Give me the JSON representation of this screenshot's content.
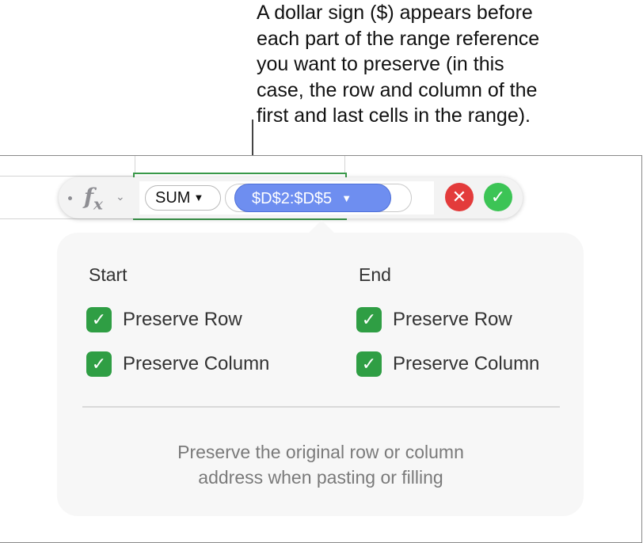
{
  "callout": {
    "text": "A dollar sign ($) appears before\neach part of the range reference\nyou want to preserve (in this\ncase, the row and column of the\nfirst and last cells in the range)."
  },
  "formula_bar": {
    "fx_label": "f",
    "fx_sub": "x",
    "function_token": "SUM",
    "range_token": "$D$2:$D$5",
    "dropdown_glyph": "▾",
    "cancel_glyph": "✕",
    "accept_glyph": "✓"
  },
  "popover": {
    "start": {
      "heading": "Start",
      "preserve_row": "Preserve Row",
      "preserve_column": "Preserve Column",
      "row_checked": true,
      "column_checked": true
    },
    "end": {
      "heading": "End",
      "preserve_row": "Preserve Row",
      "preserve_column": "Preserve Column",
      "row_checked": true,
      "column_checked": true
    },
    "hint": "Preserve the original row or column\naddress when pasting or filling"
  },
  "colors": {
    "range_token": "#6e8ef0",
    "cancel": "#e33b3b",
    "accept": "#3cc455",
    "checkbox": "#2f9e44",
    "selection": "#3a9a4a"
  }
}
